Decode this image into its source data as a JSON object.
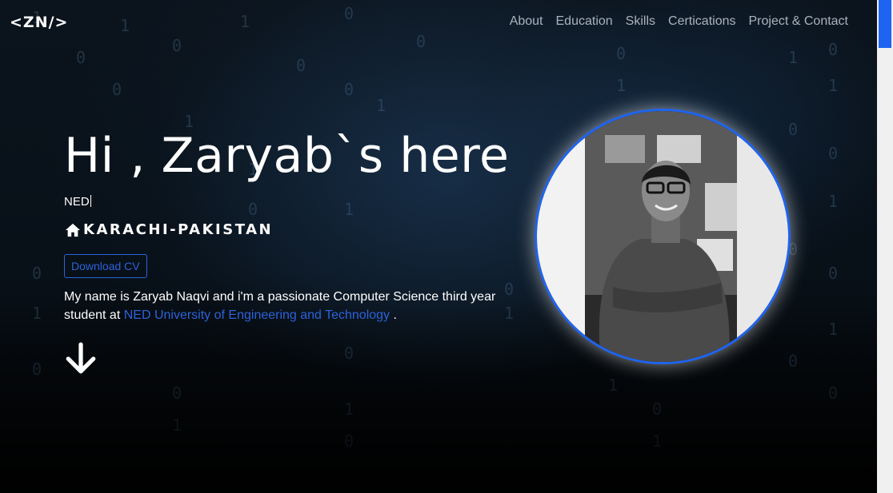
{
  "header": {
    "logo": "<ZN/>",
    "nav": [
      "About",
      "Education",
      "Skills",
      "Certications",
      "Project & Contact"
    ]
  },
  "hero": {
    "title": "Hi , Zaryab`s here",
    "typed_text": "NED",
    "location": "KARACHI-PAKISTAN",
    "cv_button": "Download CV",
    "bio_prefix": "My name is Zaryab Naqvi and i'm a passionate Computer Science third year student at ",
    "bio_link": "NED University of Engineering and Technology",
    "bio_suffix": " ."
  },
  "icons": {
    "home": "home-icon",
    "down_arrow": "arrow-down-icon"
  },
  "colors": {
    "accent": "#1f64f0",
    "link": "#2b63d9",
    "nav_text": "#aab3bd",
    "background": "#05080c"
  }
}
